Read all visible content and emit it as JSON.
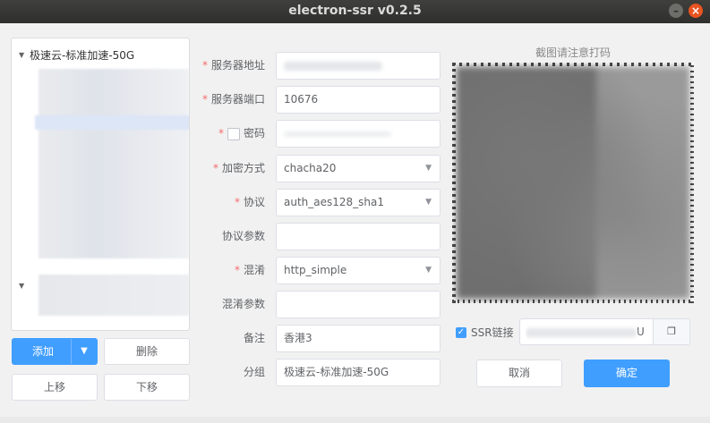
{
  "window": {
    "title": "electron-ssr v0.2.5",
    "minimize_label": "–",
    "close_label": "×"
  },
  "tree": {
    "group_label": "极速云-标准加速-50G"
  },
  "left_buttons": {
    "add": "添加",
    "delete": "删除",
    "move_up": "上移",
    "move_down": "下移"
  },
  "form": {
    "server_address": {
      "label": "服务器地址",
      "required": true,
      "value": ""
    },
    "server_port": {
      "label": "服务器端口",
      "required": true,
      "value": "10676"
    },
    "password": {
      "label": "密码",
      "required": true,
      "value": ""
    },
    "encryption": {
      "label": "加密方式",
      "required": true,
      "value": "chacha20"
    },
    "protocol": {
      "label": "协议",
      "required": true,
      "value": "auth_aes128_sha1"
    },
    "protocol_param": {
      "label": "协议参数",
      "required": false,
      "value": ""
    },
    "obfs": {
      "label": "混淆",
      "required": true,
      "value": "http_simple"
    },
    "obfs_param": {
      "label": "混淆参数",
      "required": false,
      "value": ""
    },
    "remark": {
      "label": "备注",
      "required": false,
      "value": "香港3"
    },
    "group": {
      "label": "分组",
      "required": false,
      "value": "极速云-标准加速-50G"
    }
  },
  "required_mark": "*",
  "qr": {
    "title": "截图请注意打码"
  },
  "ssr_link": {
    "checkbox_label": "SSR链接",
    "checked": true,
    "value_suffix": "U"
  },
  "actions": {
    "cancel": "取消",
    "confirm": "确定"
  },
  "colors": {
    "primary": "#409eff",
    "required": "#f56c6c",
    "titlebar": "#3c3b37"
  }
}
